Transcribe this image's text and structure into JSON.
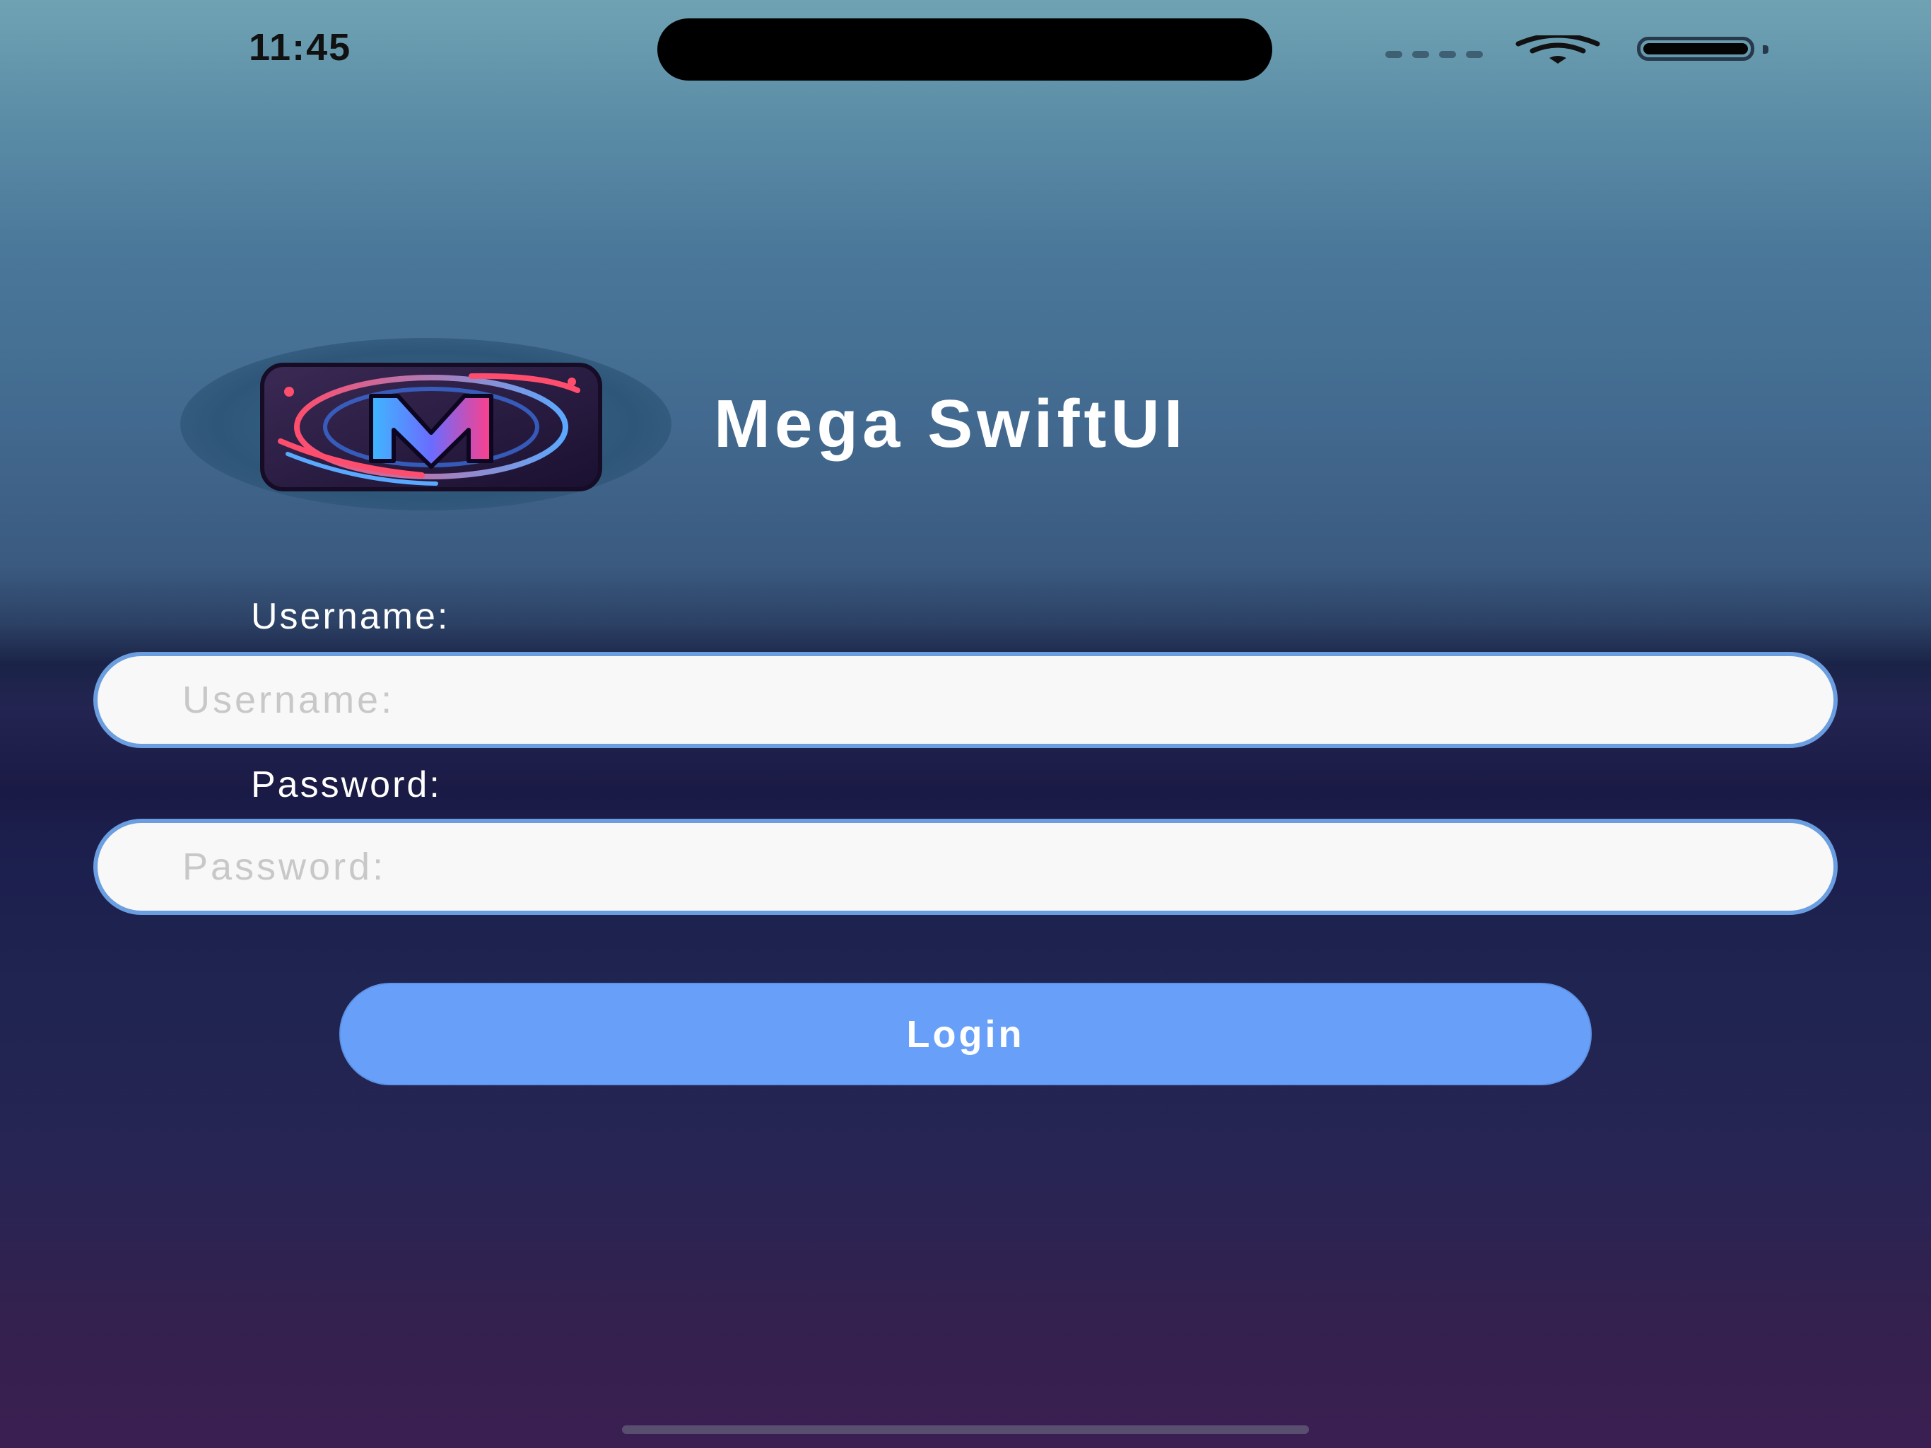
{
  "status_bar": {
    "time": "11:45"
  },
  "app": {
    "title": "Mega SwiftUI",
    "logo_letter": "M"
  },
  "form": {
    "username": {
      "label": "Username:",
      "placeholder": "Username:",
      "value": ""
    },
    "password": {
      "label": "Password:",
      "placeholder": "Password:",
      "value": ""
    },
    "login_label": "Login"
  },
  "colors": {
    "accent": "#68a0f9",
    "field_border": "#6a9ee0",
    "title_text": "#ffffff"
  },
  "icons": [
    "wifi-icon",
    "battery-icon",
    "cellular-signal-icon",
    "app-logo-icon"
  ]
}
